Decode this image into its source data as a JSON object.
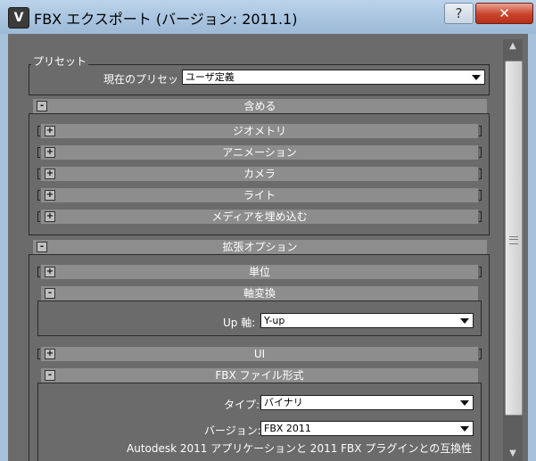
{
  "window": {
    "title": "FBX エクスポート (バージョン: 2011.1)",
    "help_label": "?",
    "close_label": "✕",
    "icon_glyph": "V"
  },
  "preset": {
    "legend": "プリセット",
    "label": "現在のプリセット:",
    "value": "ユーザ定義"
  },
  "include": {
    "toggle": "-",
    "title": "含める",
    "items": [
      {
        "toggle": "+",
        "label": "ジオメトリ"
      },
      {
        "toggle": "+",
        "label": "アニメーション"
      },
      {
        "toggle": "+",
        "label": "カメラ"
      },
      {
        "toggle": "+",
        "label": "ライト"
      },
      {
        "toggle": "+",
        "label": "メディアを埋め込む"
      }
    ]
  },
  "advanced": {
    "toggle": "-",
    "title": "拡張オプション",
    "units": {
      "toggle": "+",
      "label": "単位"
    },
    "axis": {
      "toggle": "-",
      "label": "軸変換",
      "up_axis_label": "Up 軸:",
      "up_axis_value": "Y-up"
    },
    "ui": {
      "toggle": "+",
      "label": "UI"
    },
    "fbx_format": {
      "toggle": "-",
      "label": "FBX ファイル形式",
      "type_label": "タイプ:",
      "type_value": "バイナリ",
      "version_label": "バージョン:",
      "version_value": "FBX 2011",
      "compat_note": "Autodesk 2011 アプリケーションと 2011 FBX プラグインとの互換性"
    }
  },
  "scrollbar": {
    "up_glyph": "▲",
    "down_glyph": "▼"
  }
}
